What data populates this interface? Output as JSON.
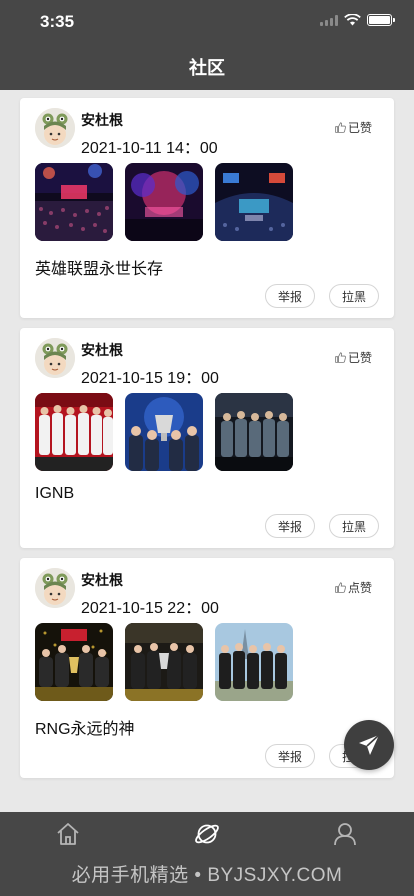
{
  "status_bar": {
    "time": "3:35"
  },
  "header": {
    "title": "社区"
  },
  "posts": [
    {
      "username": "安杜根",
      "date": "2021-10-11 14：00",
      "like_label": "已赞",
      "text": "英雄联盟永世长存",
      "report_label": "举报",
      "block_label": "拉黑",
      "images": [
        "arena-crowd-photo",
        "stage-lights-photo",
        "arena-stage-photo"
      ]
    },
    {
      "username": "安杜根",
      "date": "2021-10-15 19：00",
      "like_label": "已赞",
      "text": "IGNB",
      "report_label": "举报",
      "block_label": "拉黑",
      "images": [
        "team-lineup-photo",
        "trophy-team-photo",
        "team-on-stage-photo"
      ]
    },
    {
      "username": "安杜根",
      "date": "2021-10-15 22：00",
      "like_label": "点赞",
      "text": "RNG永远的神",
      "report_label": "举报",
      "block_label": "拉黑",
      "images": [
        "champions-celebration-photo",
        "team-with-trophy-photo",
        "team-outdoor-photo"
      ]
    }
  ],
  "fab": {
    "icon": "send-icon"
  },
  "tab_bar": {
    "icons": [
      "home-icon",
      "planet-icon",
      "profile-icon"
    ],
    "watermark": "必用手机精选 • BYJSJXY.COM"
  },
  "colors": {
    "bar": "#474747",
    "background": "#e8e8e8",
    "card": "#ffffff"
  }
}
